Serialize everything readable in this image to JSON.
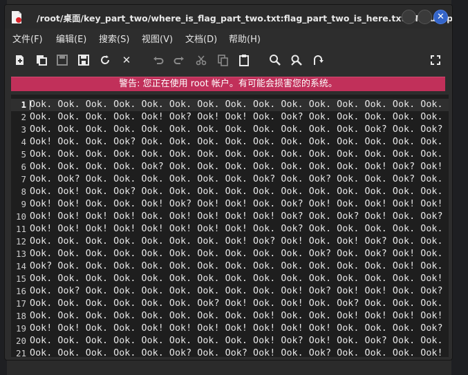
{
  "window": {
    "title": "/root/桌面/key_part_two/where_is_flag_part_two.txt:flag_part_two_is_here.txt - Mousepad"
  },
  "menu": {
    "items": [
      "文件(F)",
      "编辑(E)",
      "搜索(S)",
      "视图(V)",
      "文档(D)",
      "帮助(H)"
    ]
  },
  "toolbar": {
    "icons": [
      "new-document-icon",
      "new-window-icon",
      "save-icon",
      "save-as-icon",
      "reload-icon",
      "close-icon",
      "undo-icon",
      "redo-icon",
      "cut-icon",
      "copy-icon",
      "paste-icon",
      "search-icon",
      "replace-icon",
      "goto-icon",
      "fullscreen-icon"
    ]
  },
  "warning": {
    "text": "警告: 您正在使用 root 帐户。有可能会损害您的系统。"
  },
  "editor": {
    "lines": [
      "Ook. Ook. Ook. Ook. Ook. Ook. Ook. Ook. Ook. Ook. Ook. Ook. Ook. Ook. Ook.",
      "Ook. Ook. Ook. Ook. Ook! Ook? Ook! Ook! Ook. Ook? Ook. Ook. Ook. Ook. Ook.",
      "Ook. Ook. Ook. Ook. Ook. Ook. Ook. Ook. Ook. Ook. Ook. Ook. Ook? Ook. Ook?",
      "Ook! Ook. Ook. Ook? Ook. Ook. Ook. Ook. Ook. Ook. Ook. Ook. Ook. Ook. Ook.",
      "Ook. Ook. Ook. Ook. Ook. Ook. Ook. Ook. Ook. Ook. Ook. Ook. Ook. Ook. Ook.",
      "Ook. Ook. Ook. Ook. Ook? Ook. Ook. Ook. Ook. Ook. Ook. Ook. Ook! Ook? Ook!",
      "Ook. Ook? Ook. Ook. Ook. Ook. Ook. Ook. Ook? Ook. Ook? Ook. Ook. Ook? Ook.",
      "Ook. Ook! Ook. Ook? Ook. Ook. Ook. Ook. Ook. Ook. Ook. Ook. Ook. Ook. Ook.",
      "Ook! Ook! Ook. Ook. Ook! Ook? Ook! Ook! Ook. Ook? Ook! Ook. Ook! Ook! Ook!",
      "Ook! Ook! Ook! Ook! Ook. Ook! Ook! Ook! Ook! Ook? Ook. Ook? Ook! Ook. Ook?",
      "Ook! Ook! Ook! Ook! Ook! Ook! Ook! Ook! Ook. Ook? Ook. Ook. Ook. Ook. Ook.",
      "Ook. Ook. Ook. Ook. Ook. Ook. Ook. Ook! Ook? Ook! Ook. Ook! Ook? Ook. Ook.",
      "Ook. Ook. Ook. Ook. Ook. Ook. Ook. Ook. Ook. Ook. Ook? Ook. Ook? Ook! Ook.",
      "Ook? Ook. Ook. Ook. Ook. Ook. Ook. Ook. Ook. Ook. Ook. Ook. Ook. Ook! Ook.",
      "Ook. Ook. Ook. Ook. Ook. Ook. Ook. Ook. Ook. Ook. Ook. Ook. Ook. Ook. Ook!",
      "Ook. Ook? Ook. Ook. Ook. Ook. Ook. Ook. Ook. Ook! Ook? Ook! Ook! Ook. Ook?",
      "Ook. Ook. Ook. Ook. Ook. Ook. Ook? Ook! Ook. Ook! Ook. Ook? Ook. Ook. Ook.",
      "Ook. Ook. Ook. Ook. Ook. Ook. Ook. Ook. Ook! Ook. Ook. Ook! Ook! Ook! Ook!",
      "Ook! Ook! Ook. Ook. Ook! Ook! Ook! Ook! Ook! Ook! Ook! Ook. Ook. Ook. Ook?",
      "Ook. Ook. Ook. Ook. Ook. Ook. Ook. Ook. Ook! Ook? Ook! Ook. Ook? Ook. Ook.",
      "Ook. Ook. Ook. Ook. Ook. Ook? Ook. Ook? Ook! Ook. Ook? Ook. Ook. Ook. Ook!"
    ]
  },
  "colors": {
    "warning_bg": "#c1305a",
    "close_button": "#3465c9",
    "editor_bg": "#1e1e1e"
  }
}
